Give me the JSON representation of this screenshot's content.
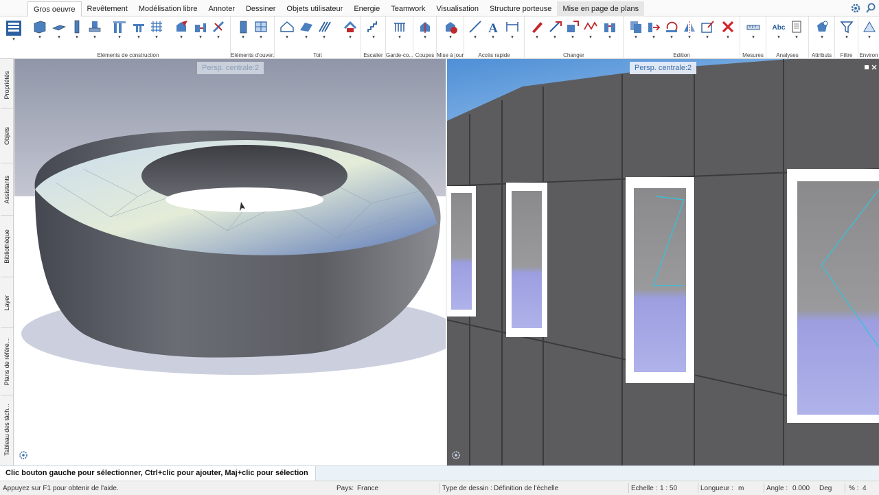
{
  "tabs": [
    "Gros oeuvre",
    "Revêtement",
    "Modélisation libre",
    "Annoter",
    "Dessiner",
    "Objets utilisateur",
    "Energie",
    "Teamwork",
    "Visualisation",
    "Structure porteuse",
    "Mise en page de plans"
  ],
  "ribbon_groups": [
    "Eléments de construction",
    "Eléments d'ouver...",
    "Toit",
    "Escalier",
    "Garde-co...",
    "Coupes",
    "Mise à jour",
    "Accès rapide",
    "Changer",
    "Edition",
    "Mesures",
    "Analyses",
    "Attributs",
    "Filtre",
    "Environ"
  ],
  "sidebar_tabs": [
    "Propriétés",
    "Objets",
    "Assistants",
    "Bibliothèque",
    "Layer",
    "Plans de référe...",
    "Tableau des tâch..."
  ],
  "viewports": {
    "left_label": "Persp. centrale:2",
    "right_label": "Persp. centrale:2"
  },
  "command_prompt": "Clic bouton gauche pour sélectionner, Ctrl+clic pour ajouter, Maj+clic pour sélection segment",
  "status": {
    "help": "Appuyez sur F1 pour obtenir de l'aide.",
    "country_label": "Pays:",
    "country": "France",
    "drawing_type_label": "Type de dessin :",
    "drawing_type": "Définition de l'échelle",
    "scale_label": "Echelle :",
    "scale": "1 : 50",
    "length_label": "Longueur :",
    "length": "m",
    "angle_label": "Angle :",
    "angle": "0.000",
    "angle_unit": "Deg",
    "percent_label": "% :",
    "percent": "4"
  },
  "colors": {
    "accent": "#1e5fa8",
    "window_frame": "#ffffff",
    "glass": "#9c9ee0",
    "cladding": "#5a5a5d"
  }
}
